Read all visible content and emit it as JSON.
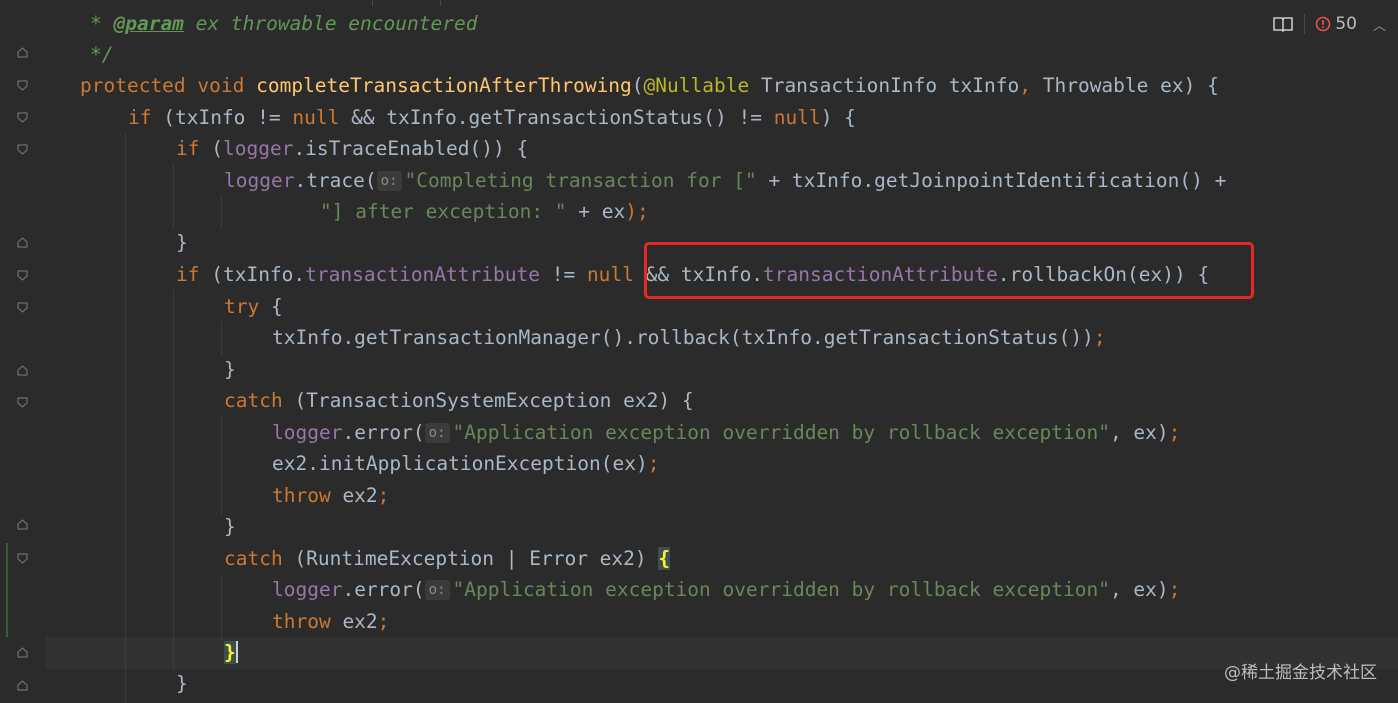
{
  "toolbar": {
    "error_count": "50"
  },
  "hints": {
    "o": "o:"
  },
  "watermark": "@稀土掘金技术社区",
  "code": {
    "l1_star": "* ",
    "l1_tag": "@param",
    "l1_text": " ex throwable encountered",
    "l2": "*/",
    "l3_kw": "protected void ",
    "l3_fn": "completeTransactionAfterThrowing",
    "l3_paren": "(",
    "l3_ann": "@Nullable",
    "l3_p1": " TransactionInfo txInfo",
    "l3_comma": ", ",
    "l3_p2": "Throwable ex) {",
    "l4_kw": "if ",
    "l4_a": "(txInfo != ",
    "l4_null1": "null",
    "l4_b": " && txInfo.getTransactionStatus() != ",
    "l4_null2": "null",
    "l4_c": ") {",
    "l5_kw": "if ",
    "l5_a": "(",
    "l5_fld": "logger",
    "l5_b": ".isTraceEnabled()) {",
    "l6_fld": "logger",
    "l6_a": ".trace(",
    "l6_str": "\"Completing transaction for [\"",
    "l6_b": " + txInfo.getJoinpointIdentification() +",
    "l7_str": "\"] after exception: \"",
    "l7_a": " + ex",
    "l7_semi": ");",
    "l8": "}",
    "l9_kw": "if ",
    "l9_a": "(txInfo.",
    "l9_fld1": "transactionAttribute",
    "l9_b": " != ",
    "l9_null": "null",
    "l9_c": " && txInfo.",
    "l9_fld2": "transactionAttribute",
    "l9_d": ".rollbackOn(ex)) {",
    "l10_kw": "try",
    "l10_a": " {",
    "l11_a": "txInfo.getTransactionManager().rollback(txInfo.getTransactionStatus())",
    "l11_semi": ";",
    "l12": "}",
    "l13_kw": "catch",
    "l13_a": " (TransactionSystemException ex2) {",
    "l14_fld": "logger",
    "l14_a": ".error(",
    "l14_str": "\"Application exception overridden by rollback exception\"",
    "l14_b": ", ex)",
    "l14_semi": ";",
    "l15_a": "ex2.initApplicationException(ex)",
    "l15_semi": ";",
    "l16_kw": "throw",
    "l16_a": " ex2",
    "l16_semi": ";",
    "l17": "}",
    "l18_kw": "catch",
    "l18_a": " (RuntimeException | Error ex2) ",
    "l18_brace": "{",
    "l19_fld": "logger",
    "l19_a": ".error(",
    "l19_str": "\"Application exception overridden by rollback exception\"",
    "l19_b": ", ex)",
    "l19_semi": ";",
    "l20_kw": "throw",
    "l20_a": " ex2",
    "l20_semi": ";",
    "l21_brace": "}",
    "l22": "}"
  }
}
